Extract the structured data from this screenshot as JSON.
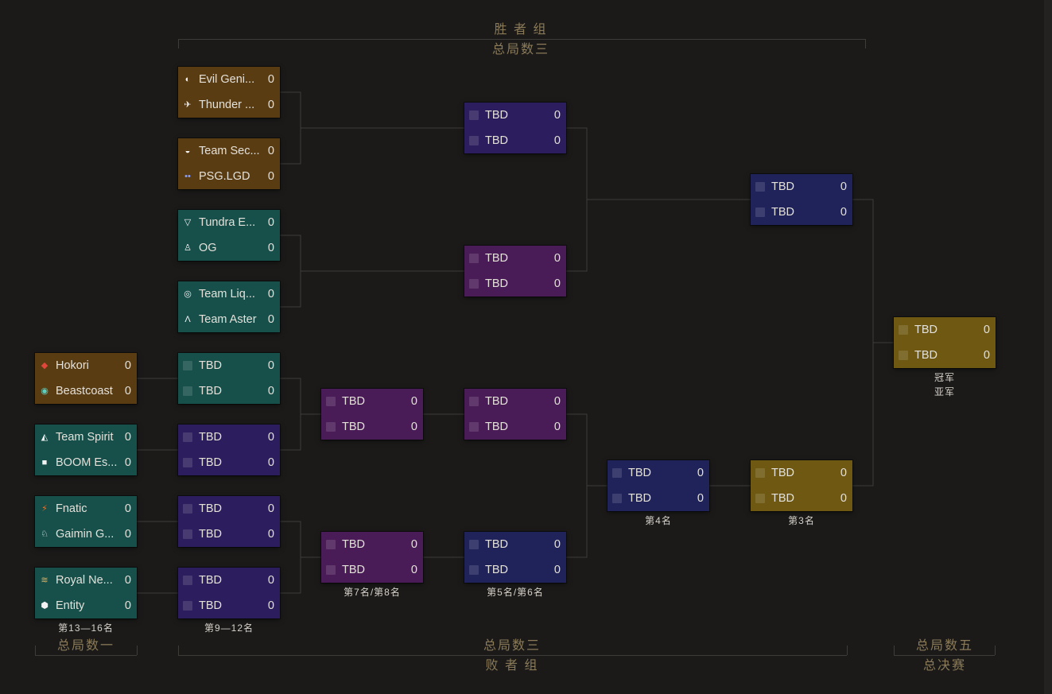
{
  "headers": {
    "winners_title": "胜 者 组",
    "winners_bo": "总局数三",
    "losers_bo": "总局数三",
    "losers_title": "败 者 组",
    "r1_bo": "总局数一",
    "final_bo": "总局数五",
    "final_title": "总决赛"
  },
  "placements": {
    "p13_16": "第13—16名",
    "p9_12": "第9—12名",
    "p7_8": "第7名/第8名",
    "p5_6": "第5名/第6名",
    "p4": "第4名",
    "p3": "第3名",
    "champion": "冠军",
    "runner_up": "亚军"
  },
  "colors": {
    "brown": "#5a3c12",
    "teal": "#17504b",
    "indigo": "#2c1e5e",
    "purple": "#4a1c57",
    "navy": "#1f235a",
    "gold": "#6e5812",
    "wire": "#3e3c39",
    "header_text": "#8a7a58"
  },
  "matches": [
    {
      "id": "ub-r1-m1",
      "color": "brown",
      "teams": [
        {
          "name": "Evil Geni...",
          "score": "0",
          "icon": "evil-geniuses-icon"
        },
        {
          "name": "Thunder ...",
          "score": "0",
          "icon": "thunder-icon"
        }
      ]
    },
    {
      "id": "ub-r1-m2",
      "color": "brown",
      "teams": [
        {
          "name": "Team Sec...",
          "score": "0",
          "icon": "team-secret-icon"
        },
        {
          "name": "PSG.LGD",
          "score": "0",
          "icon": "psg-lgd-icon"
        }
      ]
    },
    {
      "id": "ub-r1-m3",
      "color": "teal",
      "teams": [
        {
          "name": "Tundra E...",
          "score": "0",
          "icon": "tundra-icon"
        },
        {
          "name": "OG",
          "score": "0",
          "icon": "og-icon"
        }
      ]
    },
    {
      "id": "ub-r1-m4",
      "color": "teal",
      "teams": [
        {
          "name": "Team Liq...",
          "score": "0",
          "icon": "team-liquid-icon"
        },
        {
          "name": "Team Aster",
          "score": "0",
          "icon": "team-aster-icon"
        }
      ]
    },
    {
      "id": "lb-r1-m1",
      "color": "brown",
      "teams": [
        {
          "name": "Hokori",
          "score": "0",
          "icon": "hokori-icon"
        },
        {
          "name": "Beastcoast",
          "score": "0",
          "icon": "beastcoast-icon"
        }
      ]
    },
    {
      "id": "lb-r1-m2",
      "color": "teal",
      "teams": [
        {
          "name": "Team Spirit",
          "score": "0",
          "icon": "team-spirit-icon"
        },
        {
          "name": "BOOM Es...",
          "score": "0",
          "icon": "boom-esports-icon"
        }
      ]
    },
    {
      "id": "lb-r1-m3",
      "color": "teal",
      "teams": [
        {
          "name": "Fnatic",
          "score": "0",
          "icon": "fnatic-icon"
        },
        {
          "name": "Gaimin G...",
          "score": "0",
          "icon": "gaimin-gladiators-icon"
        }
      ]
    },
    {
      "id": "lb-r1-m4",
      "color": "teal",
      "teams": [
        {
          "name": "Royal Ne...",
          "score": "0",
          "icon": "royal-never-give-up-icon"
        },
        {
          "name": "Entity",
          "score": "0",
          "icon": "entity-icon"
        }
      ]
    },
    {
      "id": "lb-r2-m1",
      "color": "teal",
      "teams": [
        {
          "name": "TBD",
          "score": "0",
          "icon": "placeholder-icon"
        },
        {
          "name": "TBD",
          "score": "0",
          "icon": "placeholder-icon"
        }
      ]
    },
    {
      "id": "lb-r2-m2",
      "color": "indigo",
      "teams": [
        {
          "name": "TBD",
          "score": "0",
          "icon": "placeholder-icon"
        },
        {
          "name": "TBD",
          "score": "0",
          "icon": "placeholder-icon"
        }
      ]
    },
    {
      "id": "lb-r2-m3",
      "color": "indigo",
      "teams": [
        {
          "name": "TBD",
          "score": "0",
          "icon": "placeholder-icon"
        },
        {
          "name": "TBD",
          "score": "0",
          "icon": "placeholder-icon"
        }
      ]
    },
    {
      "id": "lb-r2-m4",
      "color": "indigo",
      "teams": [
        {
          "name": "TBD",
          "score": "0",
          "icon": "placeholder-icon"
        },
        {
          "name": "TBD",
          "score": "0",
          "icon": "placeholder-icon"
        }
      ]
    },
    {
      "id": "lb-r3-m1",
      "color": "purple",
      "teams": [
        {
          "name": "TBD",
          "score": "0",
          "icon": "placeholder-icon"
        },
        {
          "name": "TBD",
          "score": "0",
          "icon": "placeholder-icon"
        }
      ]
    },
    {
      "id": "lb-r3-m2",
      "color": "purple",
      "teams": [
        {
          "name": "TBD",
          "score": "0",
          "icon": "placeholder-icon"
        },
        {
          "name": "TBD",
          "score": "0",
          "icon": "placeholder-icon"
        }
      ]
    },
    {
      "id": "ub-r2-m1",
      "color": "indigo",
      "teams": [
        {
          "name": "TBD",
          "score": "0",
          "icon": "placeholder-icon"
        },
        {
          "name": "TBD",
          "score": "0",
          "icon": "placeholder-icon"
        }
      ]
    },
    {
      "id": "ub-r2-m2",
      "color": "purple",
      "teams": [
        {
          "name": "TBD",
          "score": "0",
          "icon": "placeholder-icon"
        },
        {
          "name": "TBD",
          "score": "0",
          "icon": "placeholder-icon"
        }
      ]
    },
    {
      "id": "lb-r4-m1",
      "color": "purple",
      "teams": [
        {
          "name": "TBD",
          "score": "0",
          "icon": "placeholder-icon"
        },
        {
          "name": "TBD",
          "score": "0",
          "icon": "placeholder-icon"
        }
      ]
    },
    {
      "id": "lb-r4-m2",
      "color": "navy",
      "teams": [
        {
          "name": "TBD",
          "score": "0",
          "icon": "placeholder-icon"
        },
        {
          "name": "TBD",
          "score": "0",
          "icon": "placeholder-icon"
        }
      ]
    },
    {
      "id": "lb-r5",
      "color": "navy",
      "teams": [
        {
          "name": "TBD",
          "score": "0",
          "icon": "placeholder-icon"
        },
        {
          "name": "TBD",
          "score": "0",
          "icon": "placeholder-icon"
        }
      ]
    },
    {
      "id": "ub-final",
      "color": "navy",
      "teams": [
        {
          "name": "TBD",
          "score": "0",
          "icon": "placeholder-icon"
        },
        {
          "name": "TBD",
          "score": "0",
          "icon": "placeholder-icon"
        }
      ]
    },
    {
      "id": "lb-final",
      "color": "gold",
      "teams": [
        {
          "name": "TBD",
          "score": "0",
          "icon": "placeholder-icon"
        },
        {
          "name": "TBD",
          "score": "0",
          "icon": "placeholder-icon"
        }
      ]
    },
    {
      "id": "grand-final",
      "color": "gold",
      "teams": [
        {
          "name": "TBD",
          "score": "0",
          "icon": "placeholder-icon"
        },
        {
          "name": "TBD",
          "score": "0",
          "icon": "placeholder-icon"
        }
      ]
    }
  ]
}
